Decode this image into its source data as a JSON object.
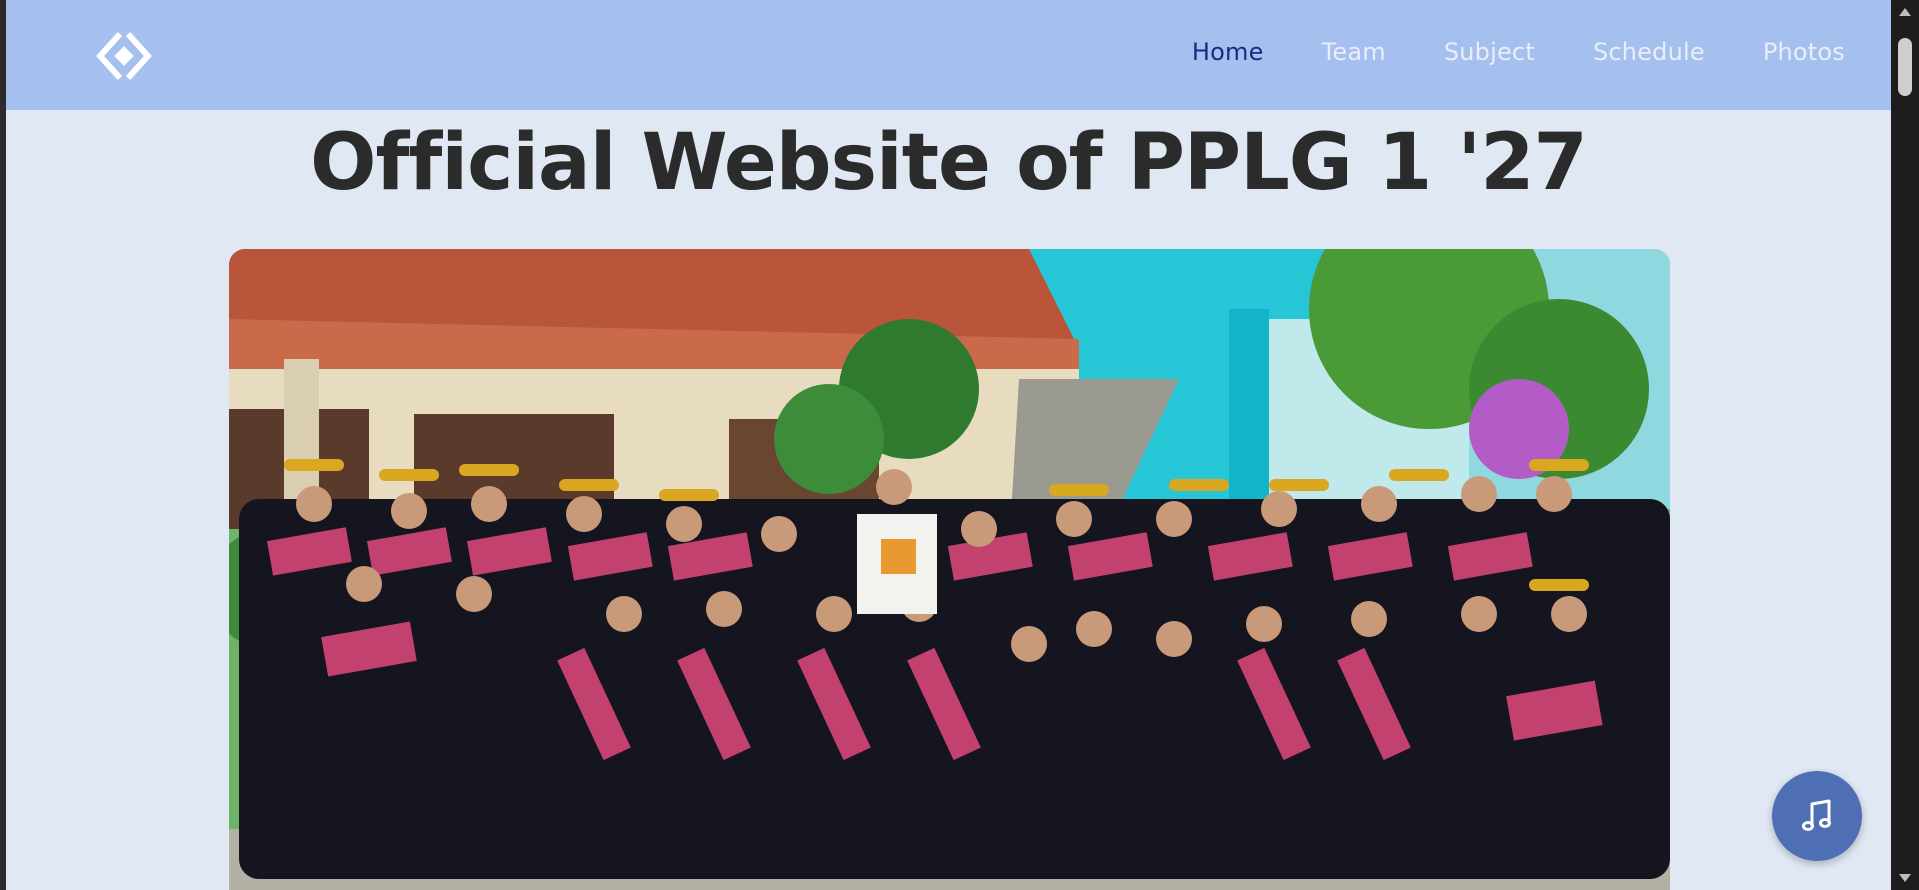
{
  "nav": {
    "items": [
      {
        "label": "Home",
        "active": true
      },
      {
        "label": "Team",
        "active": false
      },
      {
        "label": "Subject",
        "active": false
      },
      {
        "label": "Schedule",
        "active": false
      },
      {
        "label": "Photos",
        "active": false
      }
    ]
  },
  "hero": {
    "title": "Official Website of PPLG 1 '27"
  },
  "photo": {
    "subject": "class-group-photo"
  },
  "music_button": {
    "icon": "music-note-icon"
  },
  "colors": {
    "navbar": "#a5bfee",
    "page_bg": "#dfe8f3",
    "nav_active": "#1b2a86",
    "nav_inactive": "#e9eef9",
    "fab": "#4f6fb5",
    "title": "#2b2b2b"
  }
}
